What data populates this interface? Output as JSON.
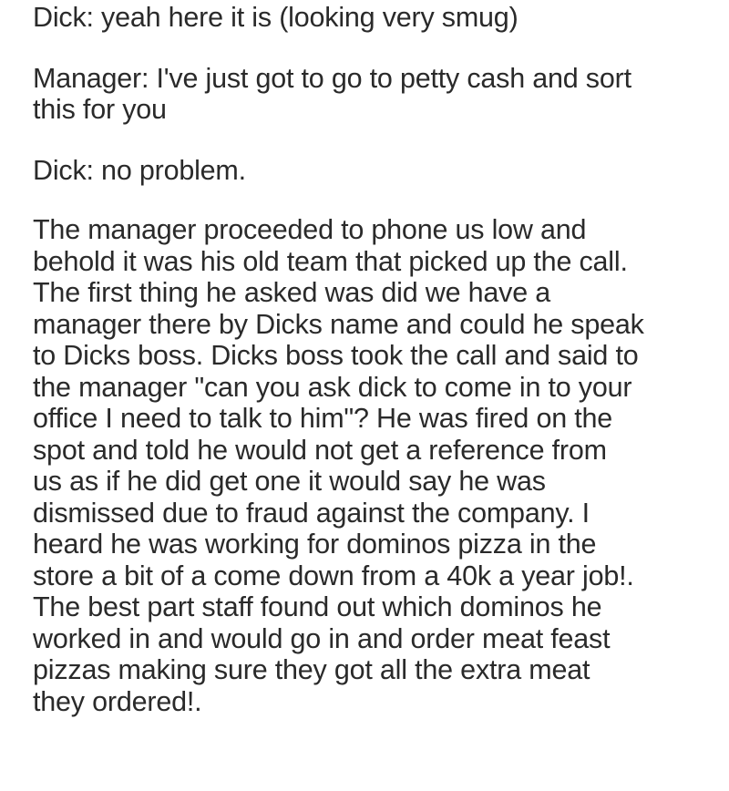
{
  "post": {
    "paragraphs": [
      {
        "lines": [
          "Dick: yeah here it is (looking very smug)"
        ]
      },
      {
        "lines": [
          "Manager: I've just got to go to petty cash and sort",
          "this for you"
        ]
      },
      {
        "lines": [
          "Dick: no problem."
        ]
      },
      {
        "lines": [
          "The manager proceeded to phone us low and",
          "behold it was his old team that picked up the call.",
          "The first thing he asked was did we have a",
          "manager there by Dicks name and could he speak",
          "to Dicks boss. Dicks boss took the call and said to",
          "the manager \"can you ask dick to come in to your",
          "office I need to talk to him\"? He was fired on the",
          "spot and told he would not get a reference from",
          "us as if he did get one it would say he was",
          "dismissed due to fraud against the company. I",
          "heard he was working for dominos pizza in the",
          "store a bit of a come down from a 40k a year job!.",
          "The best part staff found out which dominos he",
          "worked in and would go in and order meat feast",
          "pizzas making sure they got all the extra meat",
          "they ordered!."
        ]
      }
    ]
  }
}
